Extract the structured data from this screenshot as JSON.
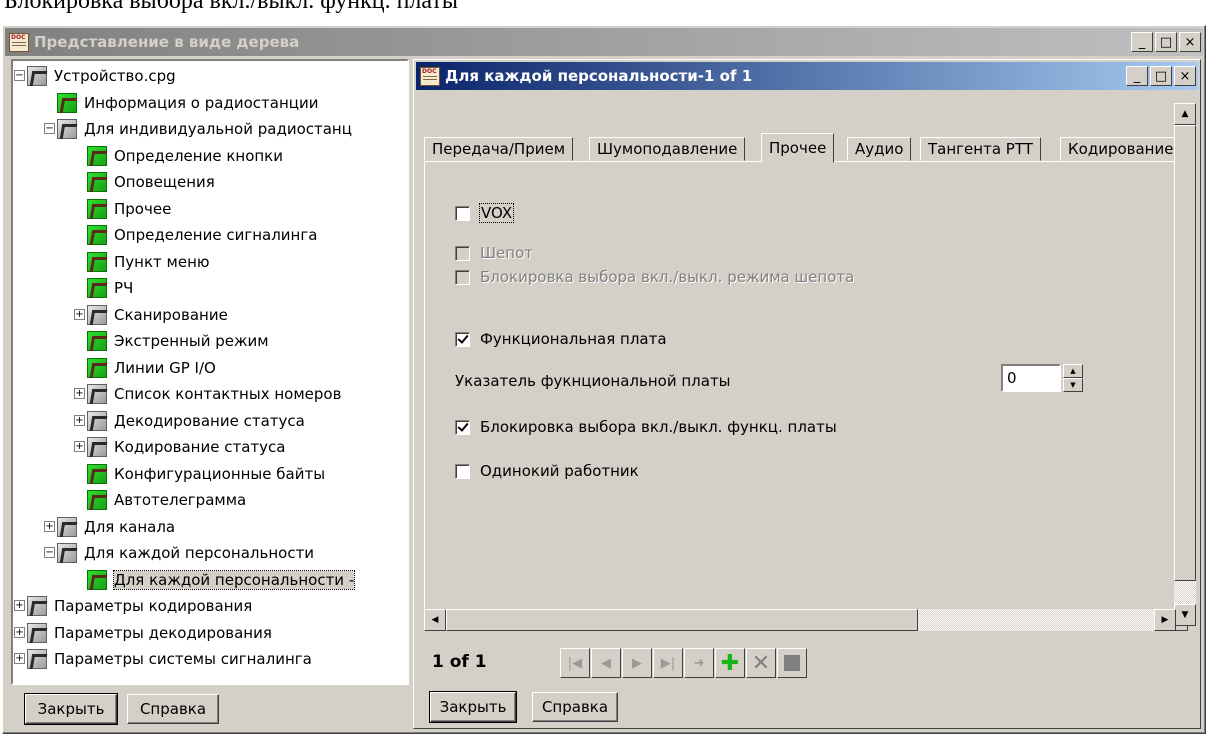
{
  "document": {
    "caption_left": "Блокировка выбора вкл./выкл. функц. платы",
    "caption_right": "«√»"
  },
  "outer_window": {
    "title": "Представление в виде дерева",
    "controls": {
      "minimize": "_",
      "maximize": "□",
      "close": "×"
    },
    "tree": [
      {
        "label": "Устройство.cpg",
        "icon": "gray",
        "expander": "−"
      },
      {
        "label": "Информация о радиостанции",
        "icon": "green"
      },
      {
        "label": "Для индивидуальной радиостанц",
        "icon": "gray",
        "expander": "−"
      },
      {
        "label": "Определение кнопки",
        "icon": "green"
      },
      {
        "label": "Оповещения",
        "icon": "green"
      },
      {
        "label": "Прочее",
        "icon": "green"
      },
      {
        "label": "Определение сигналинга",
        "icon": "green"
      },
      {
        "label": "Пункт меню",
        "icon": "green"
      },
      {
        "label": "РЧ",
        "icon": "green"
      },
      {
        "label": "Сканирование",
        "icon": "gray",
        "expander": "+"
      },
      {
        "label": "Экстренный режим",
        "icon": "green"
      },
      {
        "label": "Линии GP I/O",
        "icon": "green"
      },
      {
        "label": "Список контактных номеров",
        "icon": "gray",
        "expander": "+"
      },
      {
        "label": "Декодирование статуса",
        "icon": "gray",
        "expander": "+"
      },
      {
        "label": "Кодирование статуса",
        "icon": "gray",
        "expander": "+"
      },
      {
        "label": "Конфигурационные байты",
        "icon": "green"
      },
      {
        "label": "Автотелеграмма",
        "icon": "green"
      },
      {
        "label": "Для канала",
        "icon": "gray",
        "expander": "+"
      },
      {
        "label": "Для каждой персональности",
        "icon": "gray",
        "expander": "−"
      },
      {
        "label": "Для каждой персональности -",
        "icon": "green",
        "selected": true
      },
      {
        "label": "Параметры кодирования",
        "icon": "gray",
        "expander": "+"
      },
      {
        "label": "Параметры  декодирования",
        "icon": "gray",
        "expander": "+"
      },
      {
        "label": "Параметры системы сигналинга",
        "icon": "gray",
        "expander": "+"
      }
    ],
    "close_button": "Закрыть",
    "help_button": "Справка"
  },
  "inner_window": {
    "title": "Для каждой персональности-1 of 1",
    "controls": {
      "minimize": "_",
      "maximize": "□",
      "close": "×"
    },
    "tabs": [
      "Передача/Прием",
      "Шумоподавление",
      "Прочее",
      "Аудио",
      "Тангента PTT",
      "Кодирование"
    ],
    "active_tab": "Прочее",
    "options": {
      "vox": {
        "label": "VOX",
        "checked": false
      },
      "whisper": {
        "label": "Шепот",
        "checked": false,
        "disabled": true
      },
      "whisper_lock": {
        "label": "Блокировка выбора вкл./выкл. режима шепота",
        "checked": false,
        "disabled": true
      },
      "func_board": {
        "label": "Функциональная плата",
        "checked": true
      },
      "func_board_pointer": {
        "label": "Указатель фукнциональной платы",
        "value": "0"
      },
      "func_board_lock": {
        "label": "Блокировка выбора вкл./выкл. функц. платы",
        "checked": true
      },
      "lone_worker": {
        "label": "Одинокий работник",
        "checked": false
      }
    },
    "page_indicator": "1 of 1",
    "nav_buttons": [
      "first",
      "prev",
      "next",
      "last",
      "goto",
      "add",
      "delete",
      "stop"
    ],
    "close_button": "Закрыть",
    "help_button": "Справка"
  }
}
